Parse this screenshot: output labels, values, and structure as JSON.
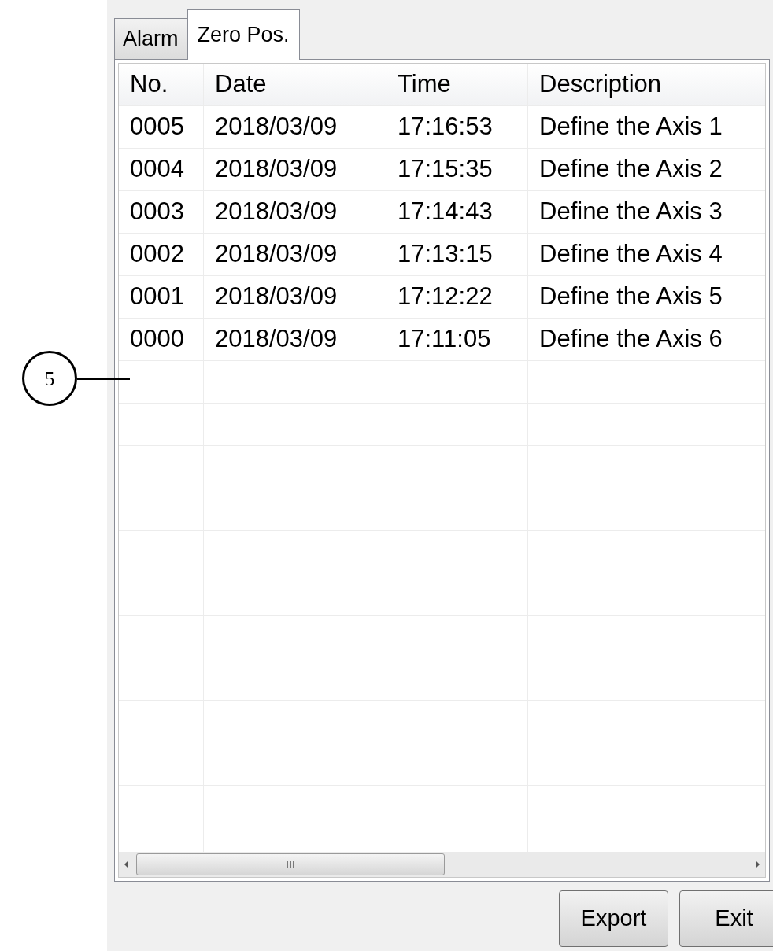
{
  "tabs": [
    {
      "label": "Alarm",
      "selected": false
    },
    {
      "label": "Zero Pos.",
      "selected": true
    }
  ],
  "table": {
    "columns": [
      "No.",
      "Date",
      "Time",
      "Description"
    ],
    "rows": [
      [
        "0005",
        "2018/03/09",
        "17:16:53",
        "Define the Axis 1"
      ],
      [
        "0004",
        "2018/03/09",
        "17:15:35",
        "Define the Axis 2"
      ],
      [
        "0003",
        "2018/03/09",
        "17:14:43",
        "Define the Axis 3"
      ],
      [
        "0002",
        "2018/03/09",
        "17:13:15",
        "Define the Axis 4"
      ],
      [
        "0001",
        "2018/03/09",
        "17:12:22",
        "Define the Axis 5"
      ],
      [
        "0000",
        "2018/03/09",
        "17:11:05",
        "Define the Axis 6"
      ]
    ]
  },
  "buttons": [
    "Export",
    "Exit"
  ],
  "callout": {
    "label": "5"
  }
}
